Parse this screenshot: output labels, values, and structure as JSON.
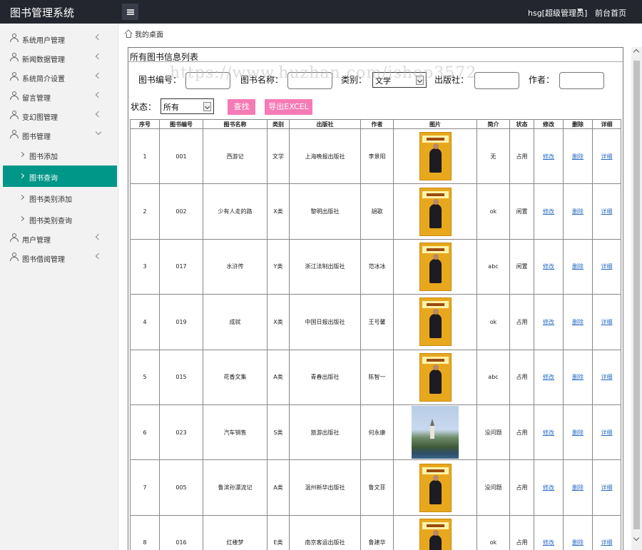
{
  "app": {
    "title": "图书管理系统",
    "user": "hsg[超级管理员]",
    "home_link": "前台首页"
  },
  "sidebar": {
    "items": [
      {
        "label": "系统用户管理"
      },
      {
        "label": "新闻数据管理"
      },
      {
        "label": "系统简介设置"
      },
      {
        "label": "留言管理"
      },
      {
        "label": "变幻图管理"
      },
      {
        "label": "图书管理"
      },
      {
        "label": "用户管理"
      },
      {
        "label": "图书借阅管理"
      }
    ],
    "subitems": [
      {
        "label": "图书添加"
      },
      {
        "label": "图书查询"
      },
      {
        "label": "图书类别添加"
      },
      {
        "label": "图书类别查询"
      }
    ]
  },
  "breadcrumb": "我的桌面",
  "panel": {
    "title": "所有图书信息列表"
  },
  "filters": {
    "book_no_label": "图书编号：",
    "book_name_label": "图书名称：",
    "category_label": "类别：",
    "category_value": "文学",
    "publisher_label": "出版社：",
    "author_label": "作者：",
    "status_label": "状态：",
    "status_value": "所有",
    "search_button": "查找",
    "export_button": "导出EXCEL"
  },
  "watermark": "https://www.huzhan.com/ishop3572",
  "table": {
    "headers": [
      "序号",
      "图书编号",
      "图书名称",
      "类别",
      "出版社",
      "作者",
      "图片",
      "简介",
      "状态",
      "修改",
      "删除",
      "详细"
    ],
    "rows": [
      {
        "idx": "1",
        "no": "001",
        "name": "西游记",
        "cat": "文学",
        "pub": "上海晚报出版社",
        "author": "李景阳",
        "img": "book",
        "intro": "无",
        "status": "占用",
        "edit": "修改",
        "del": "删除",
        "detail": "详细"
      },
      {
        "idx": "2",
        "no": "002",
        "name": "少有人走的路",
        "cat": "X类",
        "pub": "黎明出版社",
        "author": "胡歌",
        "img": "book",
        "intro": "ok",
        "status": "闲置",
        "edit": "修改",
        "del": "删除",
        "detail": "详细"
      },
      {
        "idx": "3",
        "no": "017",
        "name": "水浒传",
        "cat": "Y类",
        "pub": "浙江法制出版社",
        "author": "范冰冰",
        "img": "book",
        "intro": "abc",
        "status": "闲置",
        "edit": "修改",
        "del": "删除",
        "detail": "详细"
      },
      {
        "idx": "4",
        "no": "019",
        "name": "成就",
        "cat": "X类",
        "pub": "中国日报出版社",
        "author": "王号馨",
        "img": "book",
        "intro": "ok",
        "status": "占用",
        "edit": "修改",
        "del": "删除",
        "detail": "详细"
      },
      {
        "idx": "5",
        "no": "015",
        "name": "花香文集",
        "cat": "A类",
        "pub": "青春出版社",
        "author": "陈智一",
        "img": "book",
        "intro": "abc",
        "status": "占用",
        "edit": "修改",
        "del": "删除",
        "detail": "详细"
      },
      {
        "idx": "6",
        "no": "023",
        "name": "汽车销售",
        "cat": "S类",
        "pub": "旅游出版社",
        "author": "何永康",
        "img": "photo",
        "intro": "没问题",
        "status": "占用",
        "edit": "修改",
        "del": "删除",
        "detail": "详细"
      },
      {
        "idx": "7",
        "no": "005",
        "name": "鲁滨孙漂流记",
        "cat": "A类",
        "pub": "温州新华出版社",
        "author": "鲁文菲",
        "img": "book",
        "intro": "没问题",
        "status": "占用",
        "edit": "修改",
        "del": "删除",
        "detail": "详细"
      },
      {
        "idx": "8",
        "no": "016",
        "name": "红楼梦",
        "cat": "E类",
        "pub": "南京客运出版社",
        "author": "鲁建华",
        "img": "book",
        "intro": "ok",
        "status": "占用",
        "edit": "修改",
        "del": "删除",
        "detail": "详细"
      }
    ]
  }
}
